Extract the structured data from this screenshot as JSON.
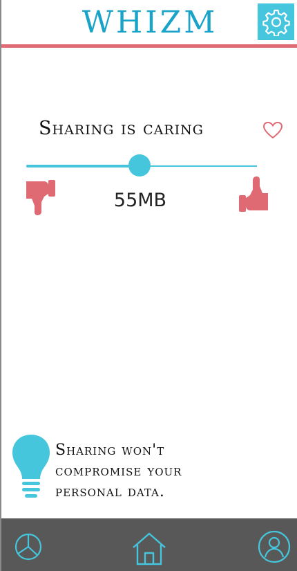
{
  "app": {
    "title": "WHIZM"
  },
  "icons": {
    "settings": "gear-icon",
    "favorite": "heart-icon",
    "dislike": "thumbs-down-icon",
    "like": "thumbs-up-icon",
    "tip": "lightbulb-icon",
    "nav_stats": "pie-chart-icon",
    "nav_home": "home-icon",
    "nav_profile": "user-icon"
  },
  "sharing": {
    "title": "Sharing is caring",
    "slider_fraction": 0.49,
    "value": "55MB"
  },
  "tip": {
    "lines": [
      "Sharing won't",
      "compromise your",
      "personal data."
    ]
  },
  "colors": {
    "accent": "#45c6dd",
    "title": "#1aa3c8",
    "danger": "#e06a73",
    "nav_bg": "#585858"
  }
}
